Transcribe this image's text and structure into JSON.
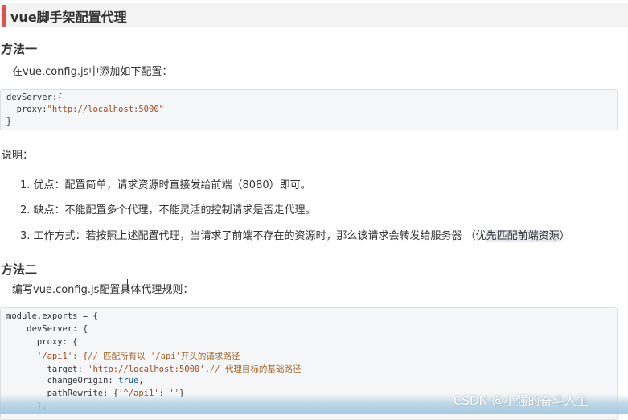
{
  "title": "vue脚手架配置代理",
  "method1": {
    "heading": "方法一",
    "intro": "在vue.config.js中添加如下配置：",
    "code": [
      "devServer:{",
      "  proxy:",
      "\"http://localhost:5000\"",
      "}"
    ]
  },
  "explain_label": "说明：",
  "list": [
    "1. 优点：配置简单，请求资源时直接发给前端（8080）即可。",
    "2. 缺点：不能配置多个代理，不能灵活的控制请求是否走代理。",
    "3. 工作方式：若按照上述配置代理，当请求了前端不存在的资源时，那么该请求会转发给服务器 （优",
    "先匹配前端资源",
    "）"
  ],
  "method2": {
    "heading": "方法二",
    "intro": "编写vue.config.js配置具体代理规则：",
    "code": {
      "l1": "module.exports = {",
      "l2": "    devServer: {",
      "l3": "      proxy: {",
      "l4a": "      '/api1': {",
      "l4b": "// 匹配所有以 '/api'开头的请求路径",
      "l5a": "        target: ",
      "l5b": "'http://localhost:5000'",
      "l5c": ",",
      "l5d": "// 代理目标的基础路径",
      "l6a": "        changeOrigin: ",
      "l6b": "true",
      "l6c": ",",
      "l7a": "        pathRewrite: {",
      "l7b": "'^/api1'",
      "l7c": ": ",
      "l7d": "''",
      "l7e": "}",
      "l8": "      },"
    }
  },
  "watermark": "CSDN @小强的奋斗人生"
}
